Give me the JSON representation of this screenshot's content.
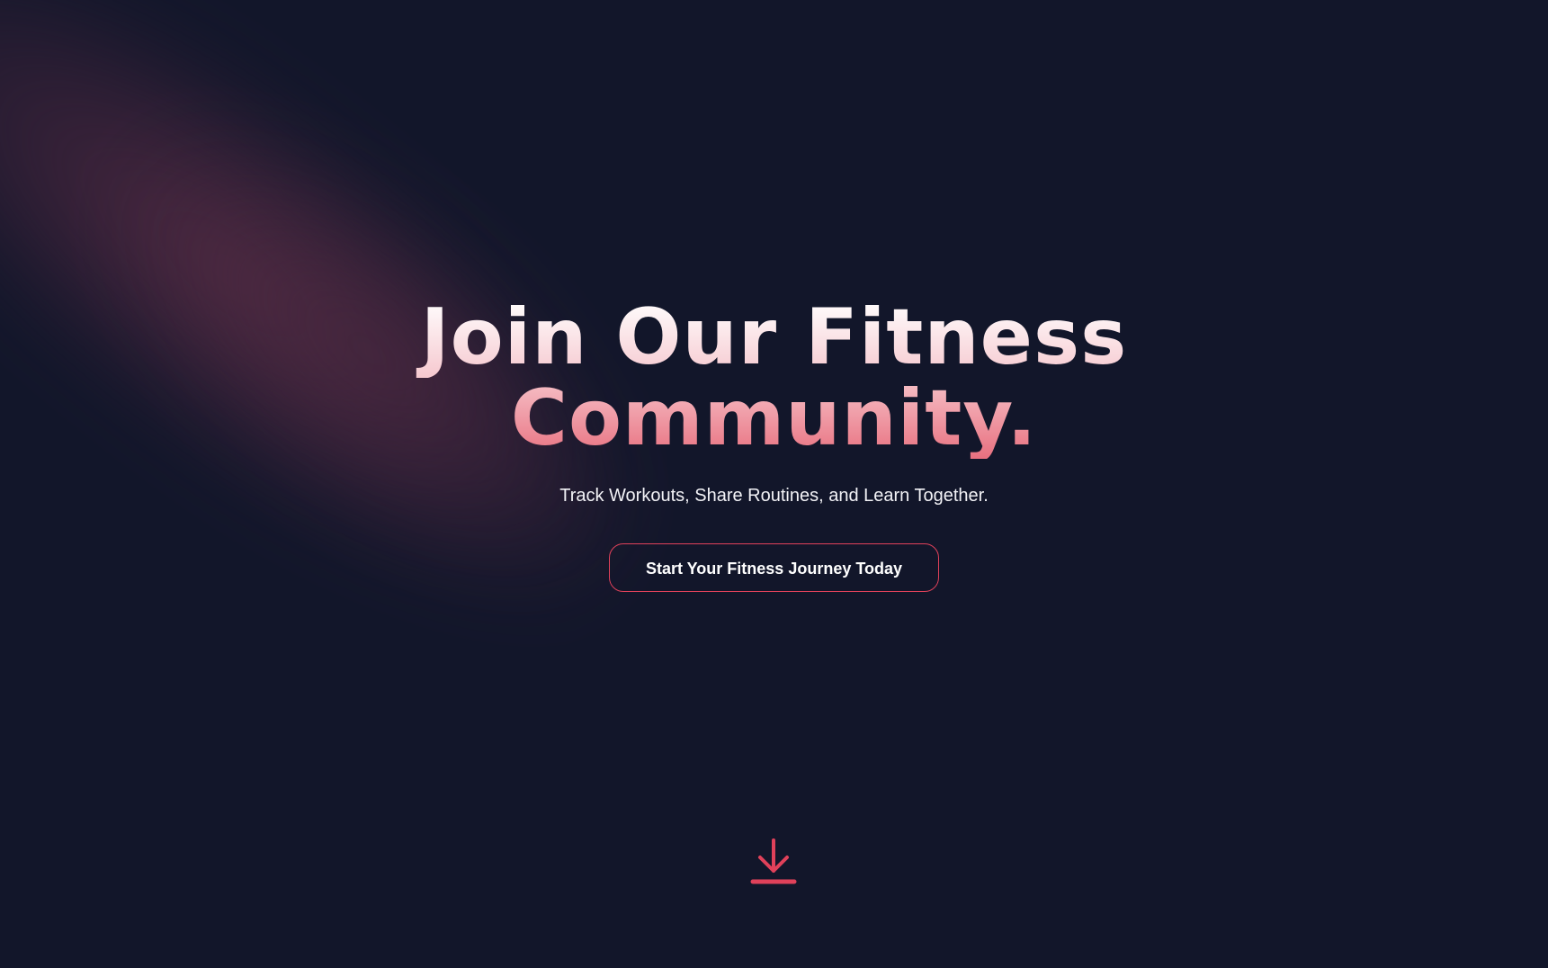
{
  "hero": {
    "headline_line1": "Join Our Fitness",
    "headline_line2": "Community.",
    "subtitle": "Track Workouts, Share Routines, and Learn Together.",
    "cta_label": "Start Your Fitness Journey Today"
  },
  "scroll_indicator": {
    "icon": "download-arrow-icon"
  },
  "colors": {
    "background": "#12162a",
    "accent": "#e0415a",
    "headline_top": "#ffffff",
    "headline_bottom": "#e8707f"
  }
}
